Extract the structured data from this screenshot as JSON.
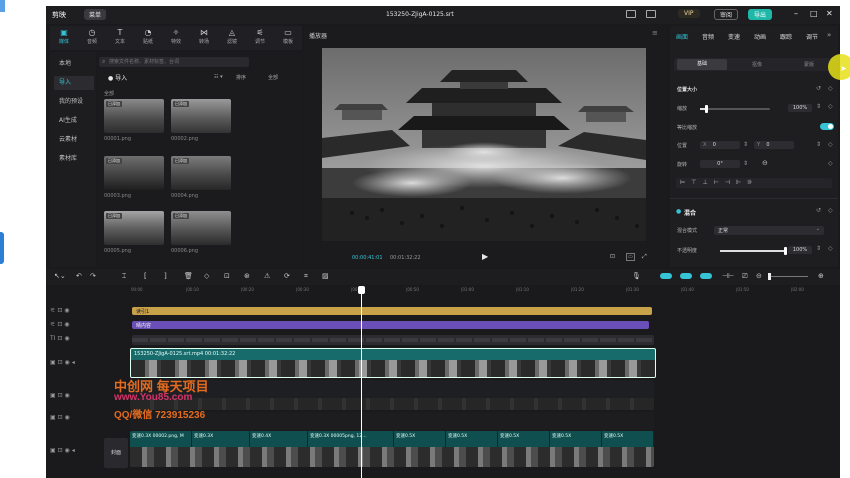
{
  "app": {
    "logo": "剪映",
    "menu": "菜单",
    "file_name": "153250-ZJigA-0125.srt",
    "vip": "VIP",
    "review_label": "审阅",
    "export_label": "导出"
  },
  "media_tabs": [
    {
      "label": "媒体",
      "icon": "media-icon",
      "glyph": "▣"
    },
    {
      "label": "音频",
      "icon": "audio-icon",
      "glyph": "◷"
    },
    {
      "label": "文本",
      "icon": "text-icon",
      "glyph": "T"
    },
    {
      "label": "贴纸",
      "icon": "sticker-icon",
      "glyph": "◔"
    },
    {
      "label": "特效",
      "icon": "effects-icon",
      "glyph": "✧"
    },
    {
      "label": "转场",
      "icon": "transition-icon",
      "glyph": "⋈"
    },
    {
      "label": "滤镜",
      "icon": "filter-icon",
      "glyph": "◬"
    },
    {
      "label": "调节",
      "icon": "adjust-icon",
      "glyph": "⚟"
    },
    {
      "label": "模板",
      "icon": "template-icon",
      "glyph": "▭"
    }
  ],
  "media_side": [
    "本地",
    "导入",
    "我的预设",
    "AI生成",
    "云素材",
    "素材库"
  ],
  "media": {
    "search_placeholder": "搜索文件名称、素材标签、台词",
    "import_label": "导入",
    "section_label": "全部",
    "sort_label": "排序",
    "filter_label": "全部",
    "added_badge": "已添加",
    "thumbs": [
      "00001.png",
      "00002.png",
      "00003.png",
      "00004.png",
      "00005.png",
      "00006.png"
    ]
  },
  "player": {
    "title": "播放器",
    "time_current": "00:00:41:01",
    "time_total": "00:01:32:22"
  },
  "props": {
    "tabs": [
      "画面",
      "音频",
      "变速",
      "动画",
      "跟踪",
      "调节"
    ],
    "subtabs": [
      "基础",
      "抠像",
      "蒙版"
    ],
    "section_pos": "位置大小",
    "scale_label": "缩放",
    "scale_value": "100%",
    "uniform_label": "等比缩放",
    "pos_label": "位置",
    "pos_x_label": "X",
    "pos_x": "0",
    "pos_y_label": "Y",
    "pos_y": "0",
    "rotate_label": "旋转",
    "rotate_value": "0°",
    "blend_title": "混合",
    "blend_mode_label": "混合模式",
    "blend_mode": "正常",
    "opacity_label": "不透明度",
    "opacity_value": "100%",
    "scale_fraction": 0.1,
    "opacity_fraction": 1.0
  },
  "ruler": [
    "00:00",
    "|00:10",
    "|00:20",
    "|00:30",
    "|00:40",
    "|00:50",
    "|01:00",
    "|01:10",
    "|01:20",
    "|01:30",
    "|01:40",
    "|01:50",
    "|02:00"
  ],
  "tracks": {
    "text1": "读引1",
    "text2": "晴内容",
    "main_clip": "153250-ZJigA-0125.srt.mp4  00:01:32:22",
    "cover_label": "封面",
    "speed_clips": [
      "变速0.3X  00002.png, M",
      "变速0.3X",
      "变速0.4X",
      "变速0.3X 00005png, 12…",
      "变速0.5X",
      "变速0.5X",
      "变速0.5X",
      "变速0.5X",
      "变速0.5X"
    ]
  },
  "watermark": {
    "line1": "中创网 每天项目",
    "line2": "www.You85.com",
    "line3": "QQ/微信 723915236"
  },
  "colors": {
    "accent": "#36c3d6",
    "export": "#1fb8a8",
    "vip": "#f3d9a0",
    "text_track": "#c8a249",
    "purple_track": "#6a4fb8",
    "video_track": "#176b6b",
    "watermark1": "#e46b1e",
    "watermark2": "#d8326a",
    "cursor_highlight": "#e5e017"
  }
}
